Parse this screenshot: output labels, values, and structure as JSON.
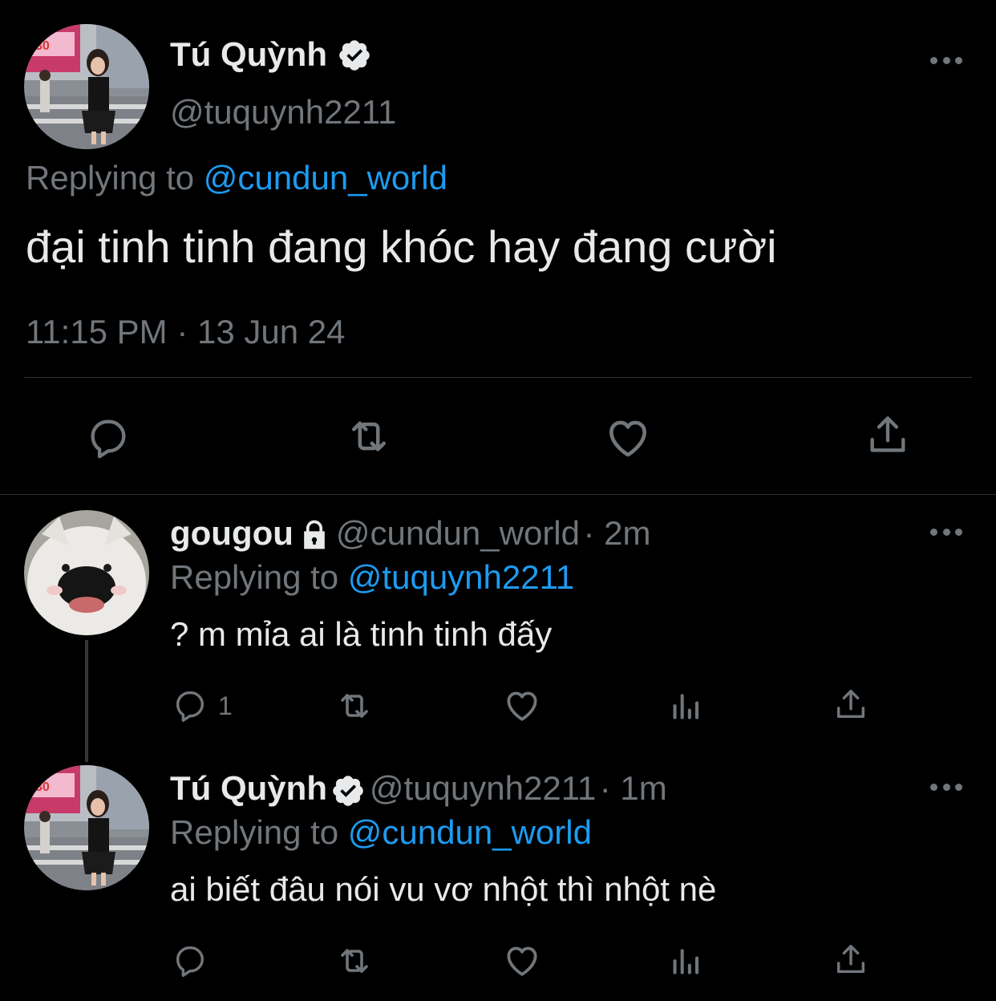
{
  "main_tweet": {
    "author_name": "Tú Quỳnh",
    "author_handle": "@tuquynh2211",
    "replying_prefix": "Replying to",
    "replying_to": "@cundun_world",
    "text": "đại tinh tinh đang khóc hay đang cười",
    "timestamp": "11:15 PM · 13 Jun 24"
  },
  "replies": [
    {
      "author_name": "gougou",
      "author_handle": "@cundun_world",
      "time": "· 2m",
      "replying_prefix": "Replying to",
      "replying_to": "@tuquynh2211",
      "text": "? m mỉa ai là tinh tinh đấy",
      "reply_count": "1",
      "protected": true
    },
    {
      "author_name": "Tú Quỳnh",
      "author_handle": "@tuquynh2211",
      "time": "· 1m",
      "replying_prefix": "Replying to",
      "replying_to": "@cundun_world",
      "text": "ai biết đâu nói vu vơ nhột thì nhột nè",
      "verified": true
    }
  ],
  "avatar_overlay": {
    "billboard_text": "30"
  },
  "colors": {
    "background": "#000000",
    "text": "#e7e9ea",
    "secondary": "#71767b",
    "link": "#1d9bf0",
    "divider": "#2f3336"
  },
  "icons": [
    "reply-icon",
    "retweet-icon",
    "like-icon",
    "views-icon",
    "share-icon",
    "verified-badge-icon",
    "lock-icon",
    "more-icon"
  ]
}
